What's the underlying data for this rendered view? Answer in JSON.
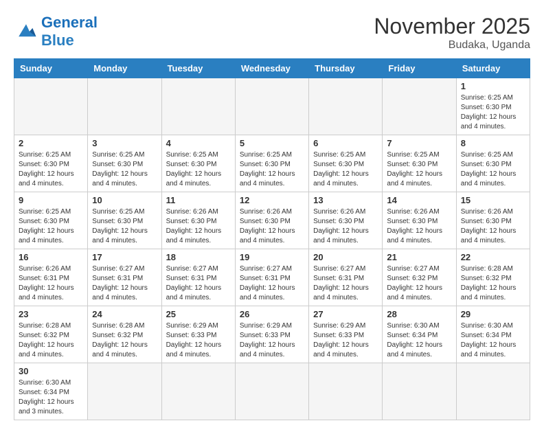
{
  "logo": {
    "general": "General",
    "blue": "Blue"
  },
  "title": "November 2025",
  "location": "Budaka, Uganda",
  "days_of_week": [
    "Sunday",
    "Monday",
    "Tuesday",
    "Wednesday",
    "Thursday",
    "Friday",
    "Saturday"
  ],
  "weeks": [
    [
      {
        "day": "",
        "empty": true
      },
      {
        "day": "",
        "empty": true
      },
      {
        "day": "",
        "empty": true
      },
      {
        "day": "",
        "empty": true
      },
      {
        "day": "",
        "empty": true
      },
      {
        "day": "",
        "empty": true
      },
      {
        "day": "1",
        "info": "Sunrise: 6:25 AM\nSunset: 6:30 PM\nDaylight: 12 hours\nand 4 minutes."
      }
    ],
    [
      {
        "day": "2",
        "info": "Sunrise: 6:25 AM\nSunset: 6:30 PM\nDaylight: 12 hours\nand 4 minutes."
      },
      {
        "day": "3",
        "info": "Sunrise: 6:25 AM\nSunset: 6:30 PM\nDaylight: 12 hours\nand 4 minutes."
      },
      {
        "day": "4",
        "info": "Sunrise: 6:25 AM\nSunset: 6:30 PM\nDaylight: 12 hours\nand 4 minutes."
      },
      {
        "day": "5",
        "info": "Sunrise: 6:25 AM\nSunset: 6:30 PM\nDaylight: 12 hours\nand 4 minutes."
      },
      {
        "day": "6",
        "info": "Sunrise: 6:25 AM\nSunset: 6:30 PM\nDaylight: 12 hours\nand 4 minutes."
      },
      {
        "day": "7",
        "info": "Sunrise: 6:25 AM\nSunset: 6:30 PM\nDaylight: 12 hours\nand 4 minutes."
      },
      {
        "day": "8",
        "info": "Sunrise: 6:25 AM\nSunset: 6:30 PM\nDaylight: 12 hours\nand 4 minutes."
      }
    ],
    [
      {
        "day": "9",
        "info": "Sunrise: 6:25 AM\nSunset: 6:30 PM\nDaylight: 12 hours\nand 4 minutes."
      },
      {
        "day": "10",
        "info": "Sunrise: 6:25 AM\nSunset: 6:30 PM\nDaylight: 12 hours\nand 4 minutes."
      },
      {
        "day": "11",
        "info": "Sunrise: 6:26 AM\nSunset: 6:30 PM\nDaylight: 12 hours\nand 4 minutes."
      },
      {
        "day": "12",
        "info": "Sunrise: 6:26 AM\nSunset: 6:30 PM\nDaylight: 12 hours\nand 4 minutes."
      },
      {
        "day": "13",
        "info": "Sunrise: 6:26 AM\nSunset: 6:30 PM\nDaylight: 12 hours\nand 4 minutes."
      },
      {
        "day": "14",
        "info": "Sunrise: 6:26 AM\nSunset: 6:30 PM\nDaylight: 12 hours\nand 4 minutes."
      },
      {
        "day": "15",
        "info": "Sunrise: 6:26 AM\nSunset: 6:30 PM\nDaylight: 12 hours\nand 4 minutes."
      }
    ],
    [
      {
        "day": "16",
        "info": "Sunrise: 6:26 AM\nSunset: 6:31 PM\nDaylight: 12 hours\nand 4 minutes."
      },
      {
        "day": "17",
        "info": "Sunrise: 6:27 AM\nSunset: 6:31 PM\nDaylight: 12 hours\nand 4 minutes."
      },
      {
        "day": "18",
        "info": "Sunrise: 6:27 AM\nSunset: 6:31 PM\nDaylight: 12 hours\nand 4 minutes."
      },
      {
        "day": "19",
        "info": "Sunrise: 6:27 AM\nSunset: 6:31 PM\nDaylight: 12 hours\nand 4 minutes."
      },
      {
        "day": "20",
        "info": "Sunrise: 6:27 AM\nSunset: 6:31 PM\nDaylight: 12 hours\nand 4 minutes."
      },
      {
        "day": "21",
        "info": "Sunrise: 6:27 AM\nSunset: 6:32 PM\nDaylight: 12 hours\nand 4 minutes."
      },
      {
        "day": "22",
        "info": "Sunrise: 6:28 AM\nSunset: 6:32 PM\nDaylight: 12 hours\nand 4 minutes."
      }
    ],
    [
      {
        "day": "23",
        "info": "Sunrise: 6:28 AM\nSunset: 6:32 PM\nDaylight: 12 hours\nand 4 minutes."
      },
      {
        "day": "24",
        "info": "Sunrise: 6:28 AM\nSunset: 6:32 PM\nDaylight: 12 hours\nand 4 minutes."
      },
      {
        "day": "25",
        "info": "Sunrise: 6:29 AM\nSunset: 6:33 PM\nDaylight: 12 hours\nand 4 minutes."
      },
      {
        "day": "26",
        "info": "Sunrise: 6:29 AM\nSunset: 6:33 PM\nDaylight: 12 hours\nand 4 minutes."
      },
      {
        "day": "27",
        "info": "Sunrise: 6:29 AM\nSunset: 6:33 PM\nDaylight: 12 hours\nand 4 minutes."
      },
      {
        "day": "28",
        "info": "Sunrise: 6:30 AM\nSunset: 6:34 PM\nDaylight: 12 hours\nand 4 minutes."
      },
      {
        "day": "29",
        "info": "Sunrise: 6:30 AM\nSunset: 6:34 PM\nDaylight: 12 hours\nand 4 minutes."
      }
    ],
    [
      {
        "day": "30",
        "info": "Sunrise: 6:30 AM\nSunset: 6:34 PM\nDaylight: 12 hours\nand 3 minutes."
      },
      {
        "day": "",
        "empty": true
      },
      {
        "day": "",
        "empty": true
      },
      {
        "day": "",
        "empty": true
      },
      {
        "day": "",
        "empty": true
      },
      {
        "day": "",
        "empty": true
      },
      {
        "day": "",
        "empty": true
      }
    ]
  ]
}
